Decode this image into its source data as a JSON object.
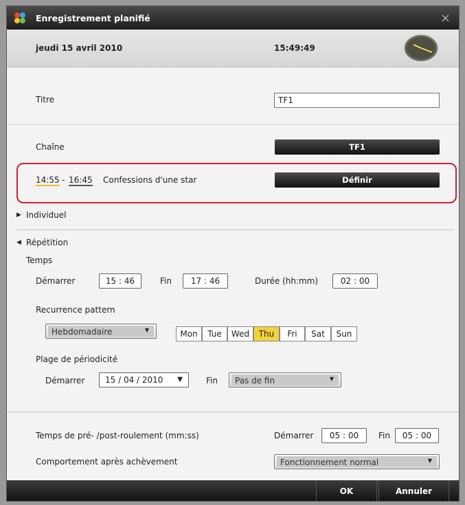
{
  "window": {
    "title": "Enregistrement planifié",
    "close": "×"
  },
  "header": {
    "date": "jeudi 15 avril 2010",
    "time": "15:49:49"
  },
  "titre": {
    "label": "Titre",
    "value": "TF1"
  },
  "chaine": {
    "label": "Chaîne",
    "button": "TF1"
  },
  "program": {
    "start": "14:55",
    "dash": "-",
    "end": "16:45",
    "name": "Confessions d'une star",
    "button": "Définir"
  },
  "individuel": {
    "arrow": "▶",
    "label": "Individuel"
  },
  "repetition": {
    "arrow": "◀",
    "label": "Répétition"
  },
  "temps": {
    "label": "Temps",
    "start_label": "Démarrer",
    "start_value": "15 : 46",
    "end_label": "Fin",
    "end_value": "17 : 46",
    "duration_label": "Durée (hh:mm)",
    "duration_value": "02 : 00"
  },
  "recurrence": {
    "label": "Recurrence pattern",
    "pattern": "Hebdomadaire",
    "days": [
      "Mon",
      "Tue",
      "Wed",
      "Thu",
      "Fri",
      "Sat",
      "Sun"
    ],
    "selected_day": "Thu",
    "highlight_color": "#f3d23c"
  },
  "plage": {
    "label": "Plage de périodicité",
    "start_label": "Démarrer",
    "start_value": "15 / 04 / 2010",
    "end_label": "Fin",
    "end_value": "Pas de fin"
  },
  "preroll": {
    "label": "Temps de pré- /post-roulement (mm:ss)",
    "start_label": "Démarrer",
    "start_value": "05 : 00",
    "end_label": "Fin",
    "end_value": "05 : 00"
  },
  "behavior": {
    "label": "Comportement après achèvement",
    "value": "Fonctionnement normal"
  },
  "footer": {
    "ok": "OK",
    "cancel": "Annuler"
  },
  "colors": {
    "highlight_box": "#d02030",
    "title_bar": "#1e1e1e"
  }
}
